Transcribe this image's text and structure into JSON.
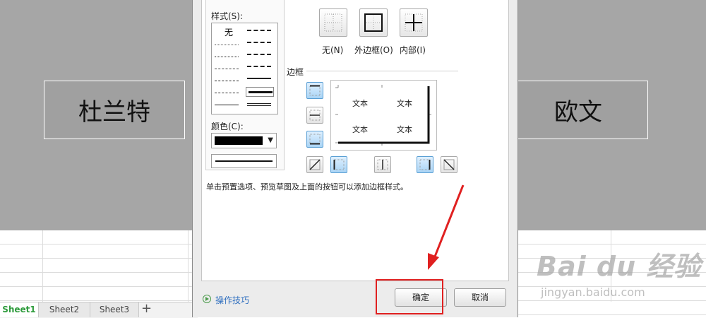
{
  "spreadsheet": {
    "cells": {
      "left": "杜兰特",
      "right": "欧文"
    },
    "tabs": [
      "Sheet1",
      "Sheet2",
      "Sheet3"
    ],
    "add_tab": "+"
  },
  "dialog": {
    "line_group": {
      "style_label": "样式(S):",
      "none_label": "无",
      "color_label": "颜色(C):",
      "color_value": "#000000"
    },
    "presets": {
      "none": "无(N)",
      "outline": "外边框(O)",
      "inside": "内部(I)"
    },
    "border_section_title": "边框",
    "preview_texts": [
      "文本",
      "文本",
      "文本",
      "文本"
    ],
    "hint": "单击预置选项、预览草图及上面的按钮可以添加边框样式。",
    "tips_link": "操作技巧",
    "ok_button": "确定",
    "cancel_button": "取消"
  },
  "annotation": {
    "color": "#e02020"
  },
  "watermark": {
    "main": "Bai du 经验",
    "sub": "jingyan.baidu.com"
  }
}
